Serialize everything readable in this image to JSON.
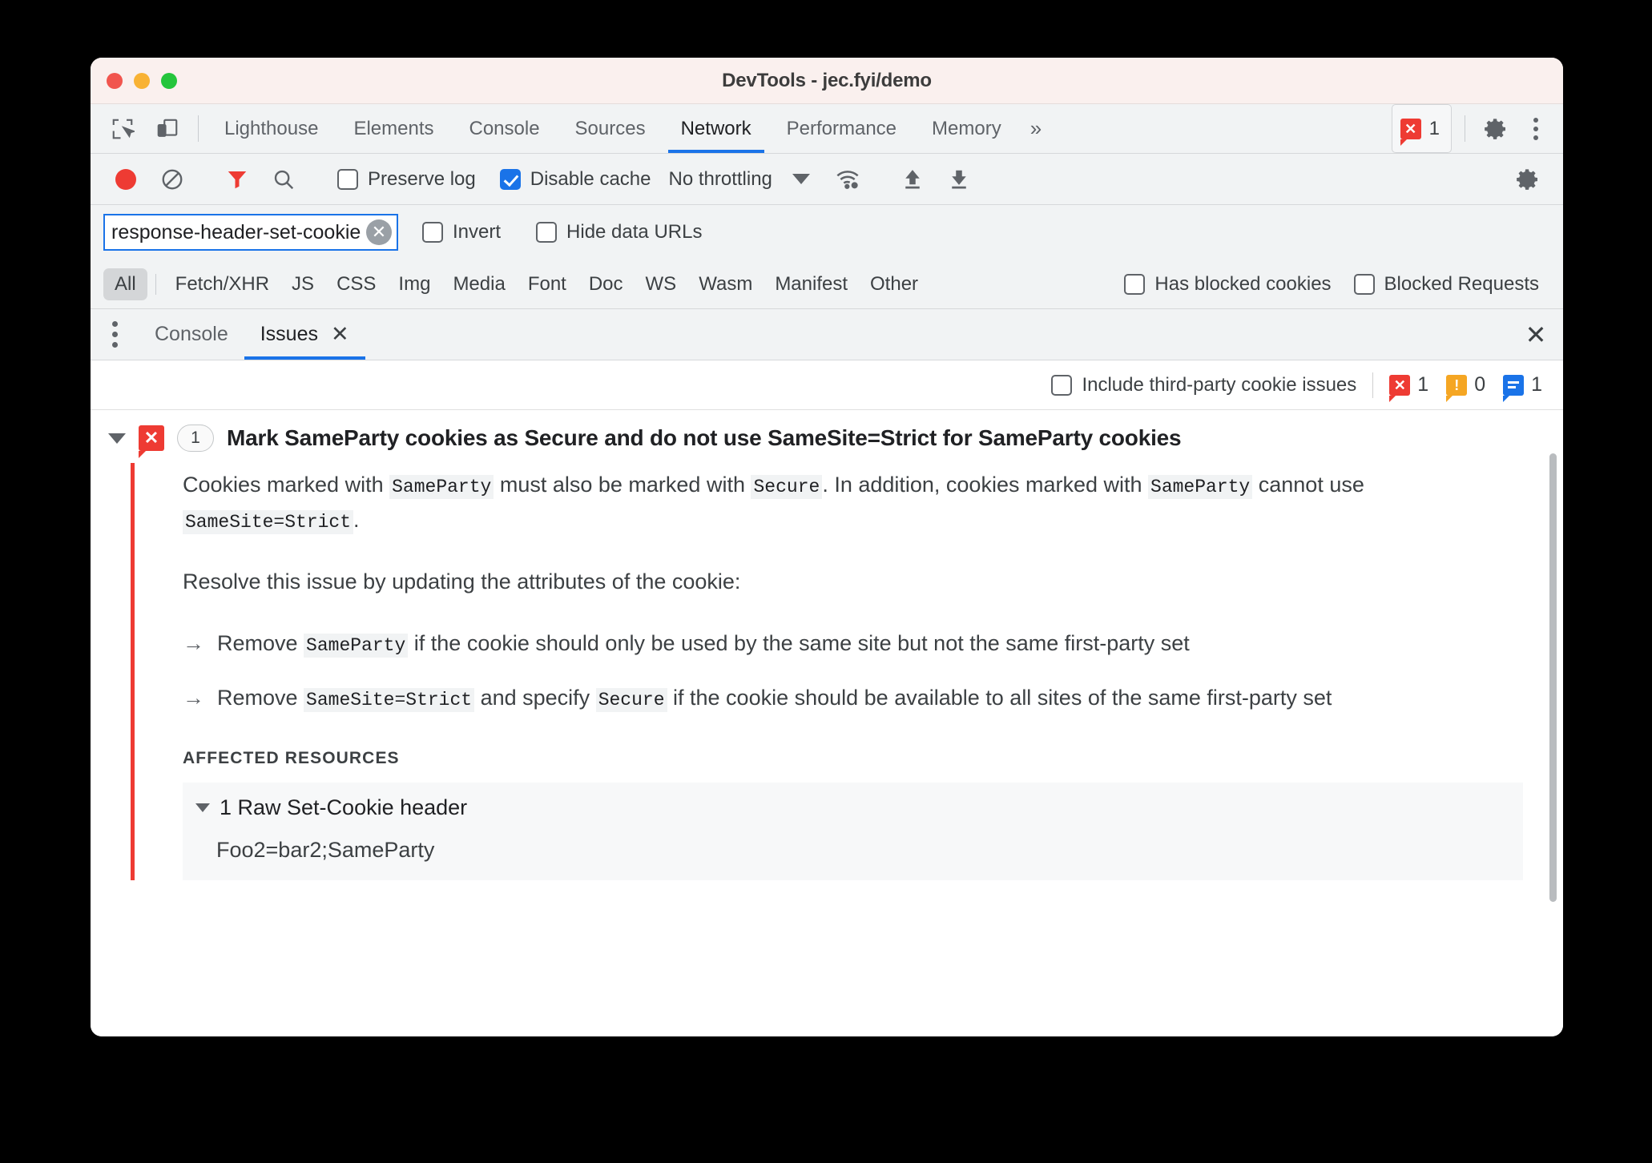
{
  "window": {
    "title": "DevTools - jec.fyi/demo",
    "traffic_lights": [
      "close",
      "minimize",
      "maximize"
    ]
  },
  "panel_tabs": {
    "items": [
      {
        "label": "Lighthouse",
        "active": false
      },
      {
        "label": "Elements",
        "active": false
      },
      {
        "label": "Console",
        "active": false
      },
      {
        "label": "Sources",
        "active": false
      },
      {
        "label": "Network",
        "active": true
      },
      {
        "label": "Performance",
        "active": false
      },
      {
        "label": "Memory",
        "active": false
      }
    ],
    "more_label": "»",
    "error_count": "1",
    "settings_icon": "gear-icon",
    "menu_icon": "kebab-menu-icon",
    "inspect_icon": "inspect-element-icon",
    "device_icon": "device-toolbar-icon"
  },
  "network_toolbar": {
    "record_icon": "record-button",
    "clear_icon": "clear-icon",
    "filter_icon": "filter-funnel-icon",
    "search_icon": "search-icon",
    "preserve_log": {
      "label": "Preserve log",
      "checked": false
    },
    "disable_cache": {
      "label": "Disable cache",
      "checked": true
    },
    "throttling": {
      "value": "No throttling"
    },
    "wifi_icon": "network-conditions-icon",
    "import_icon": "upload-har-icon",
    "export_icon": "download-har-icon",
    "settings_icon": "network-settings-gear-icon"
  },
  "filter_row": {
    "input_value": "response-header-set-cookie",
    "input_placeholder": "Filter",
    "clear_label": "✕",
    "invert": {
      "label": "Invert",
      "checked": false
    },
    "hide_data_urls": {
      "label": "Hide data URLs",
      "checked": false
    }
  },
  "type_filters": {
    "all": "All",
    "items": [
      "Fetch/XHR",
      "JS",
      "CSS",
      "Img",
      "Media",
      "Font",
      "Doc",
      "WS",
      "Wasm",
      "Manifest",
      "Other"
    ],
    "has_blocked_cookies": {
      "label": "Has blocked cookies",
      "checked": false
    },
    "blocked_requests": {
      "label": "Blocked Requests",
      "checked": false
    }
  },
  "drawer": {
    "menu_icon": "drawer-menu-icon",
    "tabs": [
      {
        "label": "Console",
        "active": false,
        "closable": false
      },
      {
        "label": "Issues",
        "active": true,
        "closable": true,
        "close_label": "✕"
      }
    ],
    "close_label": "✕"
  },
  "issues_toolbar": {
    "include_third_party": {
      "label": "Include third-party cookie issues",
      "checked": false
    },
    "counts": [
      {
        "kind": "error",
        "glyph": "✕",
        "value": "1"
      },
      {
        "kind": "warning",
        "glyph": "!",
        "value": "0"
      },
      {
        "kind": "info",
        "glyph": "",
        "value": "1"
      }
    ]
  },
  "issue": {
    "expanded": true,
    "badge_kind": "error",
    "badge_glyph": "✕",
    "occurrence_count": "1",
    "title": "Mark SameParty cookies as Secure and do not use SameSite=Strict for SameParty cookies",
    "paragraph1": {
      "part1": "Cookies marked with ",
      "code1": "SameParty",
      "part2": " must also be marked with ",
      "code2": "Secure",
      "part3": ". In addition, cookies marked with ",
      "code3": "SameParty",
      "part4": " cannot use ",
      "code4": "SameSite=Strict",
      "part5": "."
    },
    "paragraph2": "Resolve this issue by updating the attributes of the cookie:",
    "bullets": [
      {
        "arrow": "→",
        "part1": "Remove ",
        "code1": "SameParty",
        "part2": " if the cookie should only be used by the same site but not the same first-party set",
        "code2": "",
        "part3": ""
      },
      {
        "arrow": "→",
        "part1": "Remove ",
        "code1": "SameSite=Strict",
        "part2": " and specify ",
        "code2": "Secure",
        "part3": " if the cookie should be available to all sites of the same first-party set"
      }
    ],
    "affected_resources_label": "AFFECTED RESOURCES",
    "resource_group": "1 Raw Set-Cookie header",
    "resource_value": "Foo2=bar2;SameParty"
  },
  "colors": {
    "accent_blue": "#1a73e8",
    "error_red": "#ee3b33",
    "warning_orange": "#f5a623",
    "toolbar_bg": "#f1f3f4",
    "titlebar_bg": "#faf0ee"
  }
}
